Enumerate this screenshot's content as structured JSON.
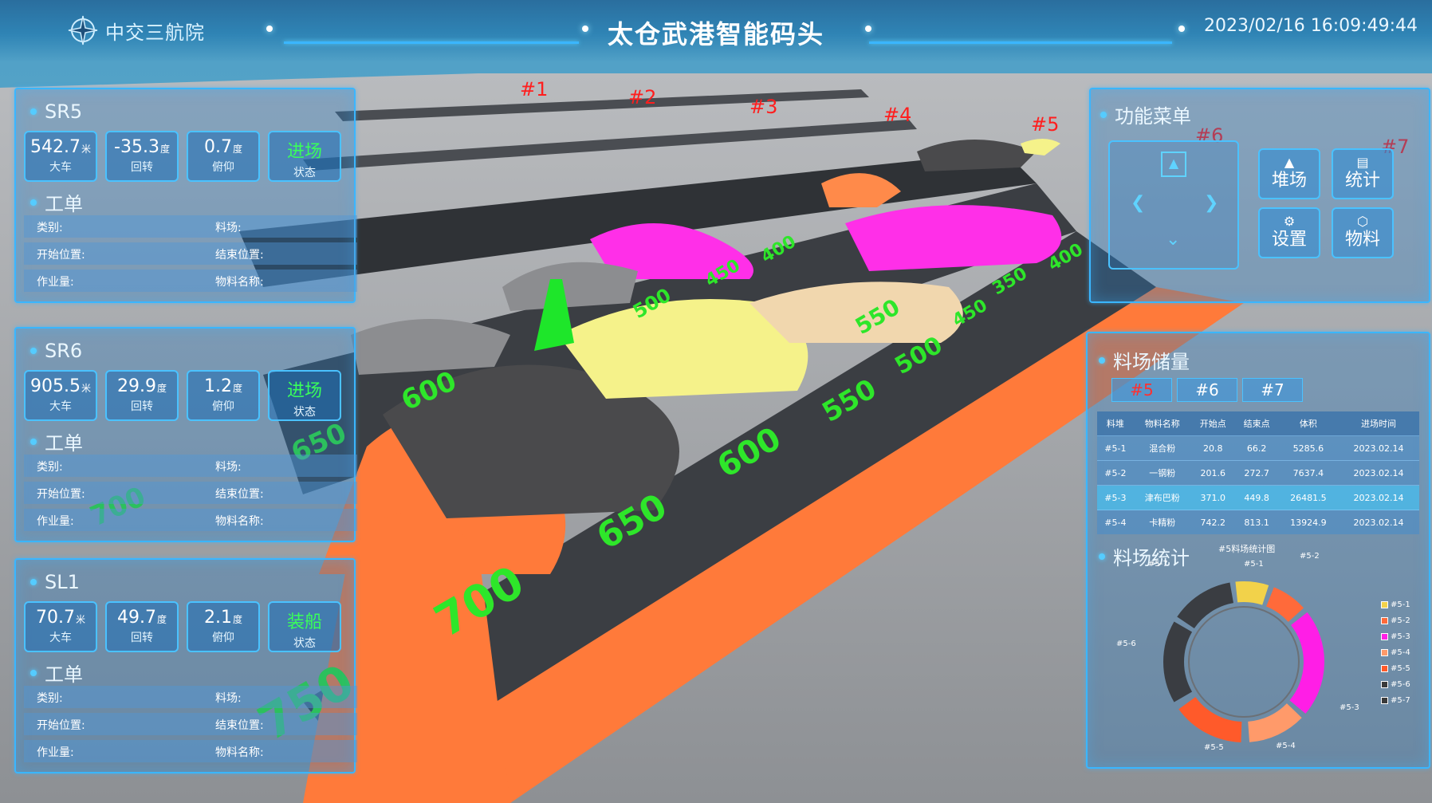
{
  "header": {
    "logo_text": "中交三航院",
    "title": "太仓武港智能码头",
    "datetime": "2023/02/16 16:09:49:44"
  },
  "yard_labels": [
    "#1",
    "#2",
    "#3",
    "#4",
    "#5",
    "#6",
    "#7"
  ],
  "track_markers": [
    "600",
    "650",
    "700",
    "750",
    "550",
    "600",
    "650",
    "700",
    "500",
    "550",
    "400",
    "450",
    "500",
    "350",
    "400",
    "450"
  ],
  "machines": [
    {
      "name": "SR5",
      "metrics": [
        {
          "value": "542.7",
          "unit": "米",
          "caption": "大车"
        },
        {
          "value": "-35.3",
          "unit": "度",
          "caption": "回转"
        },
        {
          "value": "0.7",
          "unit": "度",
          "caption": "俯仰"
        },
        {
          "value": "进场",
          "unit": "",
          "caption": "状态"
        }
      ],
      "work_order_title": "工单",
      "rows": [
        [
          "类别:",
          "料场:"
        ],
        [
          "开始位置:",
          "结束位置:"
        ],
        [
          "作业量:",
          "物料名称:"
        ]
      ]
    },
    {
      "name": "SR6",
      "metrics": [
        {
          "value": "905.5",
          "unit": "米",
          "caption": "大车"
        },
        {
          "value": "29.9",
          "unit": "度",
          "caption": "回转"
        },
        {
          "value": "1.2",
          "unit": "度",
          "caption": "俯仰"
        },
        {
          "value": "进场",
          "unit": "",
          "caption": "状态"
        }
      ],
      "work_order_title": "工单",
      "rows": [
        [
          "类别:",
          "料场:"
        ],
        [
          "开始位置:",
          "结束位置:"
        ],
        [
          "作业量:",
          "物料名称:"
        ]
      ]
    },
    {
      "name": "SL1",
      "metrics": [
        {
          "value": "70.7",
          "unit": "米",
          "caption": "大车"
        },
        {
          "value": "49.7",
          "unit": "度",
          "caption": "回转"
        },
        {
          "value": "2.1",
          "unit": "度",
          "caption": "俯仰"
        },
        {
          "value": "装船",
          "unit": "",
          "caption": "状态"
        }
      ],
      "work_order_title": "工单",
      "rows": [
        [
          "类别:",
          "料场:"
        ],
        [
          "开始位置:",
          "结束位置:"
        ],
        [
          "作业量:",
          "物料名称:"
        ]
      ]
    }
  ],
  "function_menu": {
    "title": "功能菜单",
    "buttons": [
      {
        "label": "堆场",
        "icon": "stockyard-icon"
      },
      {
        "label": "统计",
        "icon": "document-icon"
      },
      {
        "label": "设置",
        "icon": "gear-icon"
      },
      {
        "label": "物料",
        "icon": "cube-icon"
      }
    ]
  },
  "storage": {
    "title": "料场储量",
    "tabs": [
      "#5",
      "#6",
      "#7"
    ],
    "active_tab": "#5",
    "columns": [
      "料堆",
      "物料名称",
      "开始点",
      "结束点",
      "体积",
      "进场时间"
    ],
    "rows": [
      [
        "#5-1",
        "混合粉",
        "20.8",
        "66.2",
        "5285.6",
        "2023.02.14"
      ],
      [
        "#5-2",
        "一钢粉",
        "201.6",
        "272.7",
        "7637.4",
        "2023.02.14"
      ],
      [
        "#5-3",
        "津布巴粉",
        "371.0",
        "449.8",
        "26481.5",
        "2023.02.14"
      ],
      [
        "#5-4",
        "卡精粉",
        "742.2",
        "813.1",
        "13924.9",
        "2023.02.14"
      ]
    ],
    "selected_row": 2
  },
  "statistics": {
    "title": "料场统计",
    "chart_title": "#5料场统计图",
    "segments": [
      {
        "label": "#5-1",
        "color": "#f2d24a"
      },
      {
        "label": "#5-2",
        "color": "#ff6a3a"
      },
      {
        "label": "#5-3",
        "color": "#ff1ee6"
      },
      {
        "label": "#5-4",
        "color": "#ff9a6a"
      },
      {
        "label": "#5-5",
        "color": "#ff5a2a"
      },
      {
        "label": "#5-6",
        "color": "#3a3a3a"
      },
      {
        "label": "#5-7",
        "color": "#3a3a3a"
      }
    ]
  },
  "colors": {
    "accent": "#3ab6ff",
    "active_green": "#39ff5a",
    "magenta": "#ff1ee6",
    "orange": "#ff7a3a",
    "yellow": "#f5f28a"
  }
}
